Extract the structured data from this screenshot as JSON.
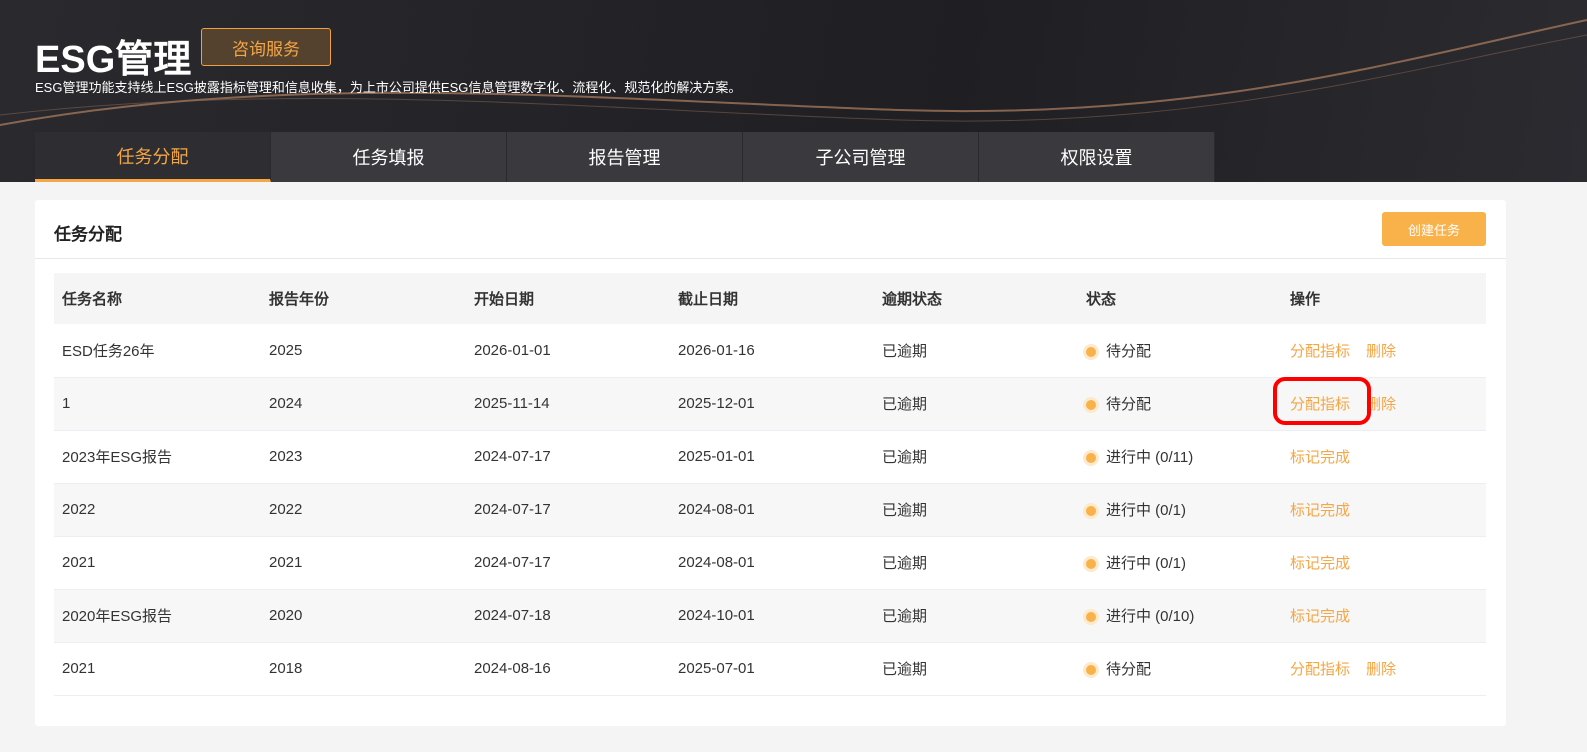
{
  "header": {
    "title": "ESG管理",
    "consult_label": "咨询服务",
    "description": "ESG管理功能支持线上ESG披露指标管理和信息收集，为上市公司提供ESG信息管理数字化、流程化、规范化的解决方案。"
  },
  "tabs": [
    {
      "label": "任务分配",
      "active": true
    },
    {
      "label": "任务填报"
    },
    {
      "label": "报告管理"
    },
    {
      "label": "子公司管理"
    },
    {
      "label": "权限设置"
    }
  ],
  "card": {
    "title": "任务分配",
    "create_label": "创建任务"
  },
  "table": {
    "columns": [
      "任务名称",
      "报告年份",
      "开始日期",
      "截止日期",
      "逾期状态",
      "状态",
      "操作"
    ],
    "rows": [
      {
        "name": "ESD任务26年",
        "year": "2025",
        "start": "2026-01-01",
        "end": "2026-01-16",
        "overdue": "已逾期",
        "status": "待分配",
        "actions": [
          "分配指标",
          "删除"
        ]
      },
      {
        "name": "1",
        "year": "2024",
        "start": "2025-11-14",
        "end": "2025-12-01",
        "overdue": "已逾期",
        "status": "待分配",
        "actions": [
          "分配指标",
          "删除"
        ]
      },
      {
        "name": "2023年ESG报告",
        "year": "2023",
        "start": "2024-07-17",
        "end": "2025-01-01",
        "overdue": "已逾期",
        "status": "进行中 (0/11)",
        "actions": [
          "标记完成"
        ]
      },
      {
        "name": "2022",
        "year": "2022",
        "start": "2024-07-17",
        "end": "2024-08-01",
        "overdue": "已逾期",
        "status": "进行中 (0/1)",
        "actions": [
          "标记完成"
        ]
      },
      {
        "name": "2021",
        "year": "2021",
        "start": "2024-07-17",
        "end": "2024-08-01",
        "overdue": "已逾期",
        "status": "进行中 (0/1)",
        "actions": [
          "标记完成"
        ]
      },
      {
        "name": "2020年ESG报告",
        "year": "2020",
        "start": "2024-07-18",
        "end": "2024-10-01",
        "overdue": "已逾期",
        "status": "进行中 (0/10)",
        "actions": [
          "标记完成"
        ]
      },
      {
        "name": "2021",
        "year": "2018",
        "start": "2024-08-16",
        "end": "2025-07-01",
        "overdue": "已逾期",
        "status": "待分配",
        "actions": [
          "分配指标",
          "删除"
        ]
      }
    ]
  },
  "colors": {
    "accent": "#f5a645",
    "status_dot": "#f9b24a",
    "highlight": "#ff0000"
  }
}
